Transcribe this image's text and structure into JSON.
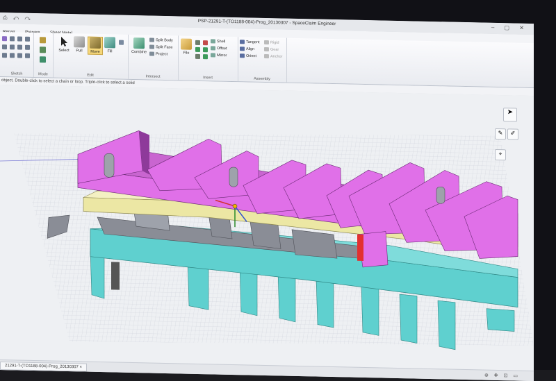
{
  "window": {
    "title": "PSP-21291-T-(TO1188-004)-Prog_20130307 - SpaceClaim Engineer",
    "quick_access_glyphs": "⎙ ↶ ↷",
    "window_controls": "– ▢ ✕"
  },
  "menu": {
    "tabs": [
      "Repair",
      "Prepare",
      "Sheet Metal"
    ]
  },
  "ribbon": {
    "groups": {
      "sketch": "Sketch",
      "mode": "Mode",
      "edit": "Edit",
      "intersect": "Intersect",
      "insert": "Insert",
      "assembly": "Assembly"
    },
    "edit": {
      "select": "Select",
      "pull": "Pull",
      "move": "Move",
      "fill": "Fill"
    },
    "intersect": {
      "combine": "Combine",
      "split_body": "Split Body",
      "split_face": "Split Face",
      "project": "Project"
    },
    "insert": {
      "file": "File",
      "shell": "Shell",
      "offset": "Offset",
      "mirror": "Mirror"
    },
    "assembly": {
      "tangent": "Tangent",
      "align": "Align",
      "orient": "Orient",
      "rigid": "Rigid",
      "gear": "Gear",
      "anchor": "Anchor"
    }
  },
  "status": {
    "hint": "object.  Double-click to select a chain or loop.  Triple-click to select a solid"
  },
  "document_tab": {
    "label": "21291-T-(TO1188-004)-Prog_20130307 ×"
  },
  "bottom_tools": "⊕ ✥ ⊡ ▭",
  "colors": {
    "magenta": "#e070e8",
    "magenta_dark": "#b64fc2",
    "magenta_side": "#8e3a9a",
    "cyan": "#5fd0cf",
    "cyan_dark": "#3ea9a8",
    "cyan_side": "#2f8684",
    "yellow": "#ece7a4",
    "yellow_dark": "#c9c27d",
    "grey_part": "#8a8d96",
    "grid": "#c7ccd6",
    "accent_red": "#e33030"
  },
  "icons": [
    "select-icon",
    "pull-icon",
    "move-icon",
    "fill-icon",
    "combine-icon",
    "file-icon",
    "cursor-arrow-icon",
    "pen-icon",
    "brush-icon",
    "snap-icon"
  ]
}
